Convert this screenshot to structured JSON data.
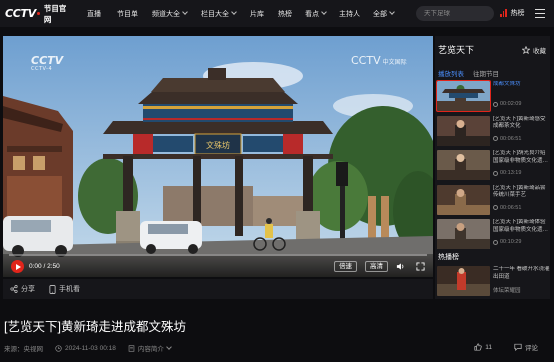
{
  "brand": {
    "logo_text": "CCTV",
    "sub_text": "节目官网"
  },
  "nav": {
    "items": [
      {
        "label": "直播",
        "caret": false
      },
      {
        "label": "节目单",
        "caret": false
      },
      {
        "label": "频道大全",
        "caret": true
      },
      {
        "label": "栏目大全",
        "caret": true
      },
      {
        "label": "片库",
        "caret": false
      },
      {
        "label": "热榜",
        "caret": false
      },
      {
        "label": "看点",
        "caret": true
      },
      {
        "label": "主持人",
        "caret": false
      },
      {
        "label": "全部",
        "caret": true
      }
    ],
    "search_placeholder": "天下足球",
    "hot_label": "热榜"
  },
  "player": {
    "watermark_left": "CCTV",
    "watermark_left_sub": "CCTV-4",
    "watermark_right": "CCTV",
    "watermark_right_sub": "中文国际",
    "gate_sign": "文殊坊",
    "time_current": "0:00",
    "time_total": "2:50",
    "time_display": "0:00 / 2:50",
    "progress_fraction": 0.0,
    "speed_label": "倍速",
    "quality_label": "高清"
  },
  "sharebar": {
    "share_label": "分享",
    "mobile_label": "手机看"
  },
  "side": {
    "title": "艺览天下",
    "fav_label": "收藏",
    "tabs": [
      {
        "label": "播放列表",
        "active": true
      },
      {
        "label": "往期节目",
        "active": false
      }
    ],
    "playlist": [
      {
        "title": "成都文殊坊",
        "duration": "00:02:09",
        "active": true
      },
      {
        "title": "[艺览天下]黄新琦感受成都茶文化",
        "duration": "00:06:51",
        "active": false
      },
      {
        "title": "[艺览天下]胡光良介绍国家级非物质文化遗…",
        "duration": "00:13:19",
        "active": false
      },
      {
        "title": "[艺览天下]黄新琦品尝传统川菜手艺",
        "duration": "00:06:51",
        "active": false
      },
      {
        "title": "[艺览天下]黄新琦体验国家级非物质文化遗…",
        "duration": "00:10:29",
        "active": false
      }
    ],
    "hot_title": "热播榜",
    "hot_item": {
      "title": "二十一年 看破开水浇灌出田道",
      "subtitle": "体坛荣耀园"
    }
  },
  "page": {
    "title": "[艺览天下]黄新琦走进成都文殊坊",
    "source": "来源：央视网",
    "date": "2024-11-03 00:18",
    "intro_label": "内容简介",
    "like_count": "11",
    "comment_label": "评论"
  },
  "colors": {
    "accent_red": "#e1251b",
    "accent_blue": "#4a8cf7",
    "bg": "#0d0d10",
    "panel": "#16161a"
  }
}
